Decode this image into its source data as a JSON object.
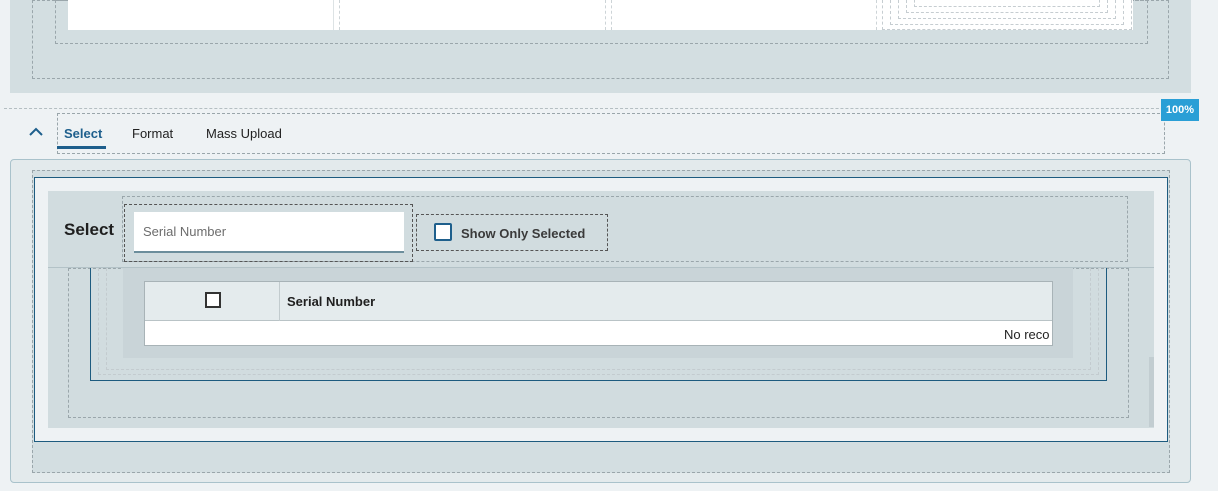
{
  "tabs": [
    {
      "label": "Select",
      "active": true
    },
    {
      "label": "Format",
      "active": false
    },
    {
      "label": "Mass Upload",
      "active": false
    }
  ],
  "zoom": "100%",
  "select_panel": {
    "title": "Select",
    "search_placeholder": "Serial Number",
    "show_only_selected": "Show Only Selected",
    "show_only_selected_checked": false
  },
  "table": {
    "columns": [
      "Serial Number"
    ],
    "empty_message": "No reco"
  },
  "icons": {
    "collapse": "chevron-up-icon",
    "select_all": "checkbox-icon"
  },
  "colors": {
    "accent": "#1e5f8c",
    "badge": "#2a9fd6",
    "panel": "#d1dcdf"
  }
}
